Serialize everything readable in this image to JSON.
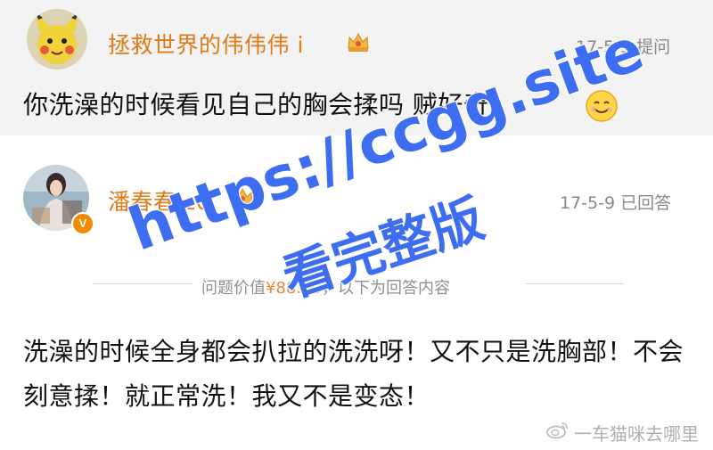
{
  "question": {
    "username": "拯救世界的伟伟伟 i",
    "date": "17-5-5",
    "action": "提问",
    "text": "你洗澡的时候看见自己的胸会揉吗 贼好奇",
    "emoji": "smile-emoji"
  },
  "answer": {
    "username": "潘春春 cc",
    "date": "17-5-9",
    "action": "已回答",
    "verified_badge": "V",
    "text": "洗澡的时候全身都会扒拉的洗洗呀！又不只是洗胸部！不会刻意揉！就正常洗！我又不是变态！"
  },
  "divider": {
    "prefix": "问题价值",
    "price": "¥88.00",
    "suffix": "，以下为回答内容"
  },
  "source": {
    "platform_icon": "weibo-icon",
    "author": "一车猫咪去哪里"
  },
  "watermark": {
    "line1": "https://ccgg.site",
    "line2": "看完整版"
  },
  "colors": {
    "username": "#e07b17",
    "meta": "#8a8a8a",
    "question_bg": "#f3f3f3",
    "watermark": "#3d6ef2",
    "verified": "#f08a00"
  }
}
